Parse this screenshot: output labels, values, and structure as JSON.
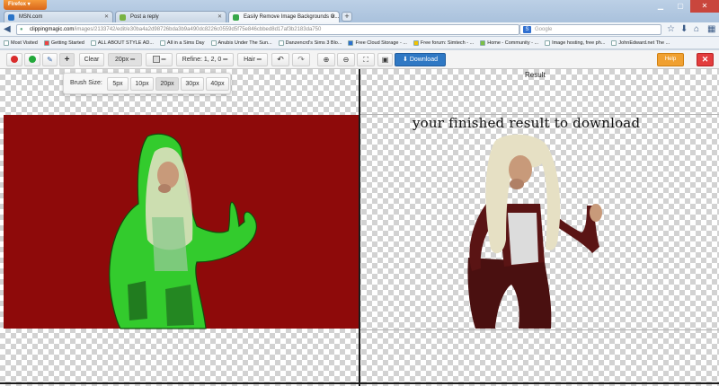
{
  "browser": {
    "menu_button": "Firefox",
    "tabs": [
      {
        "label": "MSN.com",
        "active": false
      },
      {
        "label": "Post a reply",
        "active": false
      },
      {
        "label": "Easily Remove Image Backgrounds O...",
        "active": true
      }
    ],
    "new_tab": "+",
    "url_host": "clippingmagic.com",
    "url_path": "/images/2133742/edit/e30ba4a2d98726bda3b9a490dc8226c0559d5f75e846cbbed8d17af3b2183da750",
    "search_placeholder": "Google",
    "bookmarks": [
      "Most Visited",
      "Getting Started",
      "ALL ABOUT STYLE AD...",
      "All in a Sims Day",
      "Anubis Under The Sun...",
      "Danzencrd's Sims 3 Blo...",
      "Free Cloud Storage - ...",
      "Free forum: Simtech - ...",
      "Home - Community - ...",
      "Image hosting, free ph...",
      "JohnEdward.net  The ..."
    ]
  },
  "toolbar": {
    "clear": "Clear",
    "brush_size_value": "20px",
    "refine_label": "Refine: 1, 2, 0",
    "hair_label": "Hair",
    "download": "Download",
    "help": "Help",
    "close": "✕"
  },
  "brush_popup": {
    "label": "Brush Size:",
    "options": [
      "5px",
      "10px",
      "20px",
      "30px",
      "40px"
    ],
    "selected": "20px"
  },
  "result": {
    "label": "Result",
    "caption": "your finished result to download"
  },
  "colors": {
    "accent_blue": "#2f78c4",
    "help_orange": "#f0a030",
    "close_red": "#e33d3d",
    "foreground_green": "#2ee82e",
    "background_red": "#8e0a0a"
  }
}
